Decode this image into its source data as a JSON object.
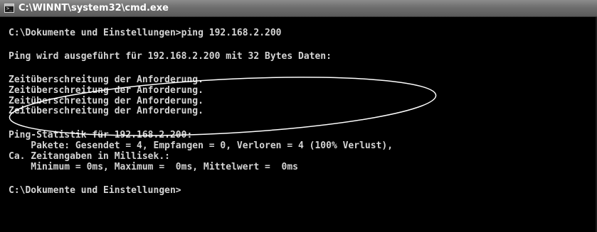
{
  "window": {
    "title": "C:\\WINNT\\system32\\cmd.exe",
    "icon": "console-icon"
  },
  "console": {
    "lines": [
      "C:\\Dokumente und Einstellungen>ping 192.168.2.200",
      "Ping wird ausgeführt für 192.168.2.200 mit 32 Bytes Daten:",
      "Zeitüberschreitung der Anforderung.",
      "Zeitüberschreitung der Anforderung.",
      "Zeitüberschreitung der Anforderung.",
      "Zeitüberschreitung der Anforderung.",
      "Ping-Statistik für 192.168.2.200:",
      "    Pakete: Gesendet = 4, Empfangen = 0, Verloren = 4 (100% Verlust),",
      "Ca. Zeitangaben in Millisek.:",
      "    Minimum = 0ms, Maximum =  0ms, Mittelwert =  0ms",
      "C:\\Dokumente und Einstellungen>"
    ]
  },
  "colors": {
    "console_background": "#000000",
    "console_text": "#d4d4d4",
    "titlebar": "#6e6e6e",
    "annotation_stroke": "#ffffff"
  }
}
